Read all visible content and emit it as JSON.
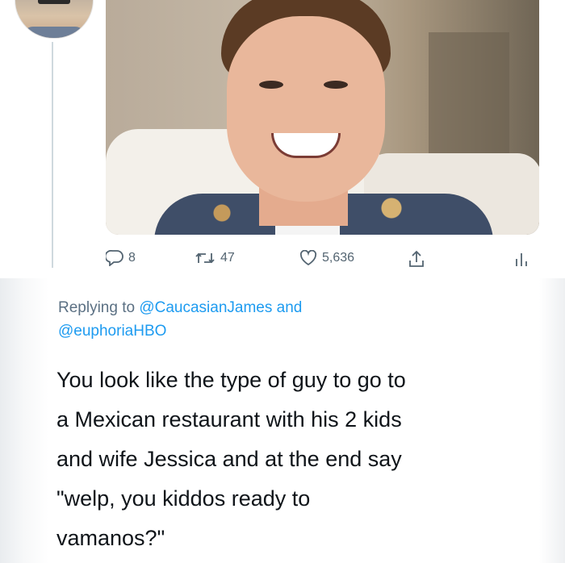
{
  "top_tweet": {
    "counts": {
      "replies": "8",
      "retweets": "47",
      "likes": "5,636"
    },
    "icons": [
      "reply-icon",
      "retweet-icon",
      "like-icon",
      "share-icon",
      "analytics-icon"
    ]
  },
  "reply": {
    "replying_prefix": "Replying to",
    "mention_1": "@CaucasianJames",
    "joiner": "and",
    "mention_2": "@euphoriaHBO",
    "lines": [
      "You look like the type of guy to go to",
      "a Mexican restaurant with his 2 kids",
      "and wife Jessica and at the end say",
      "\"welp, you kiddos ready to",
      "vamanos?\""
    ]
  },
  "colors": {
    "accent": "#1d9bf0",
    "muted": "#536471",
    "text": "#0f1419"
  }
}
